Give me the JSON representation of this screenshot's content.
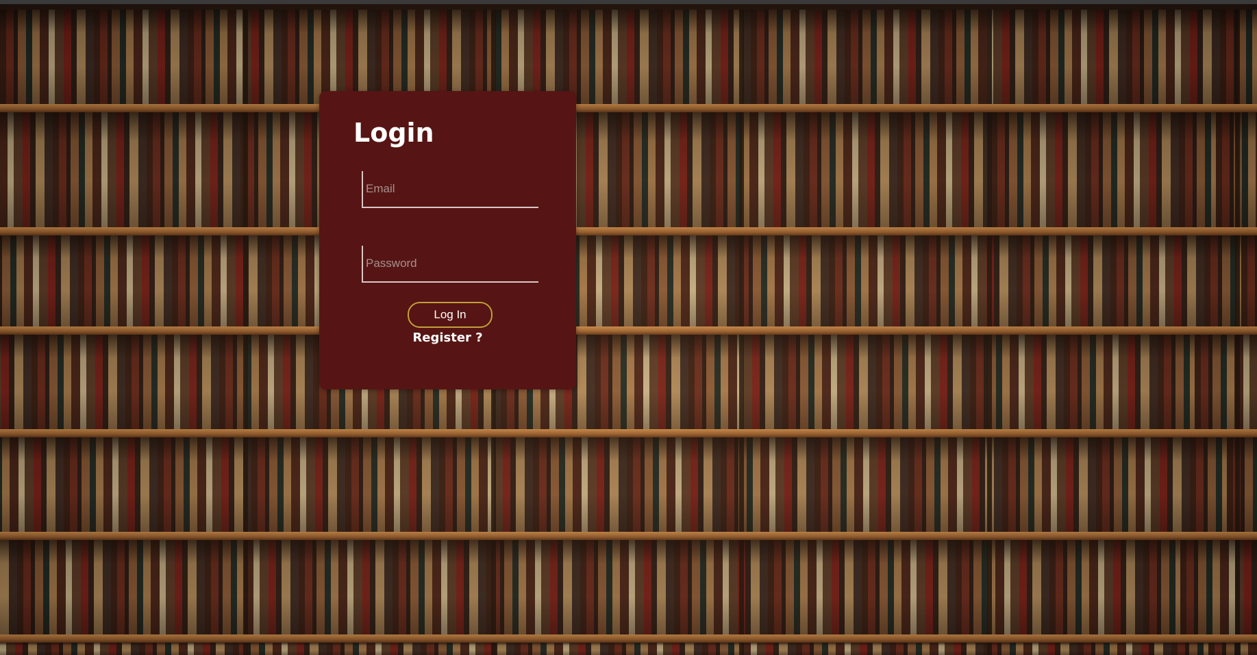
{
  "background": {
    "description_icon": "bookshelf-photo"
  },
  "login": {
    "title": "Login",
    "email_placeholder": "Email",
    "email_value": "",
    "password_placeholder": "Password",
    "password_value": "",
    "submit_label": "Log In",
    "register_label": "Register ?"
  },
  "colors": {
    "card_background": "#561514",
    "button_border": "#c2a03a",
    "text": "#ffffff"
  }
}
